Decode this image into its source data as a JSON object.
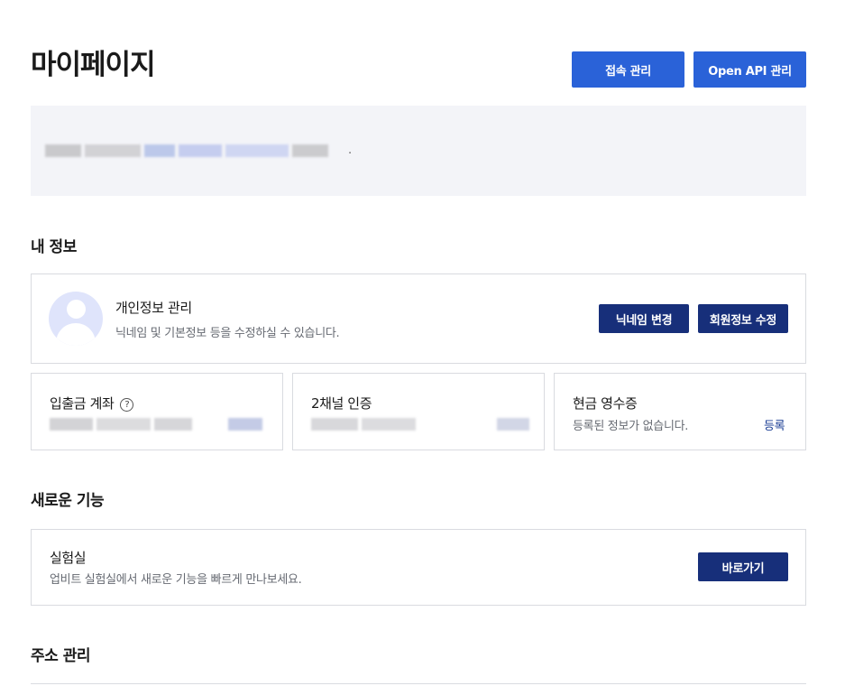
{
  "page": {
    "title": "마이페이지"
  },
  "header_buttons": {
    "access": "접속 관리",
    "open_api": "Open API 관리"
  },
  "notice": {
    "end_punct": "."
  },
  "my_info": {
    "heading": "내 정보",
    "profile": {
      "title": "개인정보 관리",
      "desc": "닉네임 및 기본정보 등을 수정하실 수 있습니다.",
      "nickname_button": "닉네임 변경",
      "edit_button": "회원정보 수정"
    },
    "deposit": {
      "title": "입출금 계좌",
      "help": "?"
    },
    "two_factor": {
      "title": "2채널 인증"
    },
    "cash_receipt": {
      "title": "현금 영수증",
      "desc": "등록된 정보가 없습니다.",
      "register_link": "등록"
    }
  },
  "new_features": {
    "heading": "새로운 기능",
    "lab": {
      "title": "실험실",
      "desc": "업비트 실험실에서 새로운 기능을 빠르게 만나보세요.",
      "go_button": "바로가기"
    }
  },
  "address": {
    "heading": "주소 관리"
  },
  "colors": {
    "primary_blue": "#2a62d8",
    "navy": "#172f7a",
    "notice_bg": "#f3f4f8",
    "border": "#d9dbe0",
    "avatar_bg": "#dfe4fb"
  },
  "icons": {
    "avatar": "default-user-avatar",
    "help": "question-circle-icon"
  }
}
